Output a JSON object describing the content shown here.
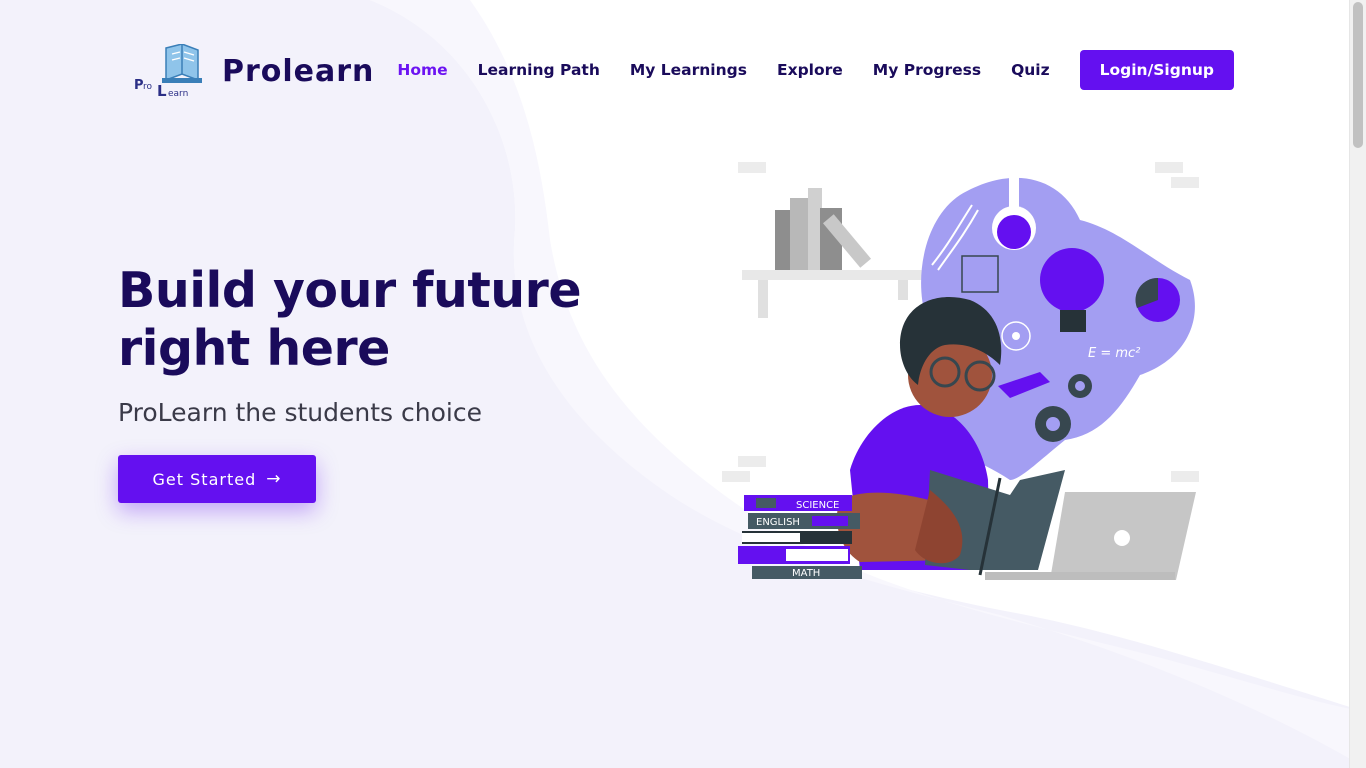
{
  "brand": {
    "logo_text": "ProLearn",
    "name": "Prolearn"
  },
  "nav": {
    "items": [
      {
        "label": "Home",
        "active": true
      },
      {
        "label": "Learning Path",
        "active": false
      },
      {
        "label": "My Learnings",
        "active": false
      },
      {
        "label": "Explore",
        "active": false
      },
      {
        "label": "My Progress",
        "active": false
      },
      {
        "label": "Quiz",
        "active": false
      }
    ],
    "login_label": "Login/Signup"
  },
  "hero": {
    "title": "Build your future right here",
    "subtitle": "ProLearn the students choice",
    "cta_label": "Get Started",
    "cta_icon": "arrow-right-icon"
  },
  "illustration": {
    "books": [
      "SCIENCE",
      "ENGLISH",
      "MATH"
    ],
    "formula": "E = mc²"
  },
  "colors": {
    "accent": "#6410f0",
    "heading": "#1a0b5b",
    "body_text": "#3a3a48",
    "wave": "#f3f2fb",
    "illustration_cloud": "#a39ef2"
  }
}
